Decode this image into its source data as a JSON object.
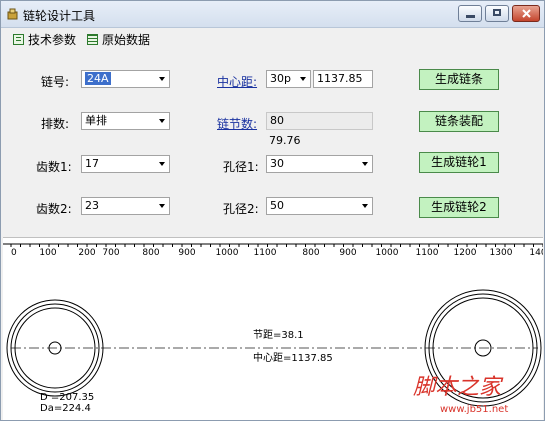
{
  "window": {
    "title": "链轮设计工具"
  },
  "menu": [
    {
      "label": "技术参数"
    },
    {
      "label": "原始数据"
    }
  ],
  "form": {
    "chain_no": {
      "label": "链号:",
      "value": "24A"
    },
    "rows": {
      "label": "排数:",
      "value": "单排"
    },
    "teeth1": {
      "label": "齿数1:",
      "value": "17"
    },
    "teeth2": {
      "label": "齿数2:",
      "value": "23"
    },
    "center_distance": {
      "label": "中心距:",
      "unit_value": "30p",
      "value": "1137.85"
    },
    "link_count": {
      "label": "链节数:",
      "value": "80",
      "sub_value": "79.76"
    },
    "bore1": {
      "label": "孔径1:",
      "value": "30"
    },
    "bore2": {
      "label": "孔径2:",
      "value": "50"
    }
  },
  "buttons": {
    "gen_chain": "生成链条",
    "chain_assembly": "链条装配",
    "gen_sprocket1": "生成链轮1",
    "gen_sprocket2": "生成链轮2"
  },
  "ruler": [
    "0",
    "100",
    "200",
    "700",
    "800",
    "900",
    "1000",
    "1100",
    "800",
    "900",
    "1000",
    "1100",
    "1200",
    "1300",
    "140"
  ],
  "drawing": {
    "pitch_text": "节距=38.1",
    "center_text": "中心距=1137.85",
    "d_text": "D =207.35",
    "da_text": "Da=224.4"
  },
  "watermark": {
    "main": "脚本之家",
    "url": "www.jb51.net"
  },
  "colors": {
    "button_green": "#c3f2c0",
    "watermark_red": "#d9342b"
  }
}
